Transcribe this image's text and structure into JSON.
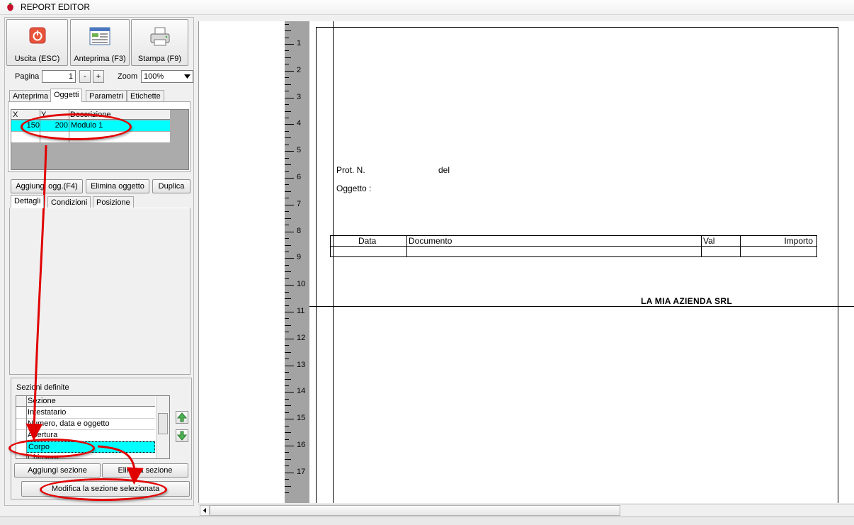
{
  "window": {
    "title": "REPORT EDITOR"
  },
  "toolbar": {
    "exit_label": "Uscita (ESC)",
    "preview_label": "Anteprima (F3)",
    "print_label": "Stampa (F9)",
    "page_label": "Pagina",
    "page_value": "1",
    "minus_label": "-",
    "plus_label": "+",
    "zoom_label": "Zoom",
    "zoom_value": "100%"
  },
  "tabs_top": [
    "Anteprima",
    "Oggetti",
    "Parametri",
    "Etichette"
  ],
  "objects_grid": {
    "headers": [
      "X",
      "Y",
      "Descrizione"
    ],
    "rows": [
      {
        "x": "150",
        "y": "200",
        "desc": "Modulo 1"
      }
    ]
  },
  "object_buttons": {
    "add": "Aggiungi ogg.(F4)",
    "delete": "Elimina oggetto",
    "duplicate": "Duplica"
  },
  "tabs_detail": [
    "Dettagli",
    "Condizioni",
    "Posizione"
  ],
  "sections": {
    "title": "Sezioni definite",
    "header": "Sezione",
    "items": [
      "Intestatario",
      "Numero, data e oggetto",
      "Apertura",
      "Corpo",
      "Chiusura"
    ],
    "add_label": "Aggiungi sezione",
    "delete_label": "Elimina sezione",
    "modify_label": "Modifica la sezione selezionata"
  },
  "ruler": {
    "numbers": [
      "1",
      "2",
      "3",
      "4",
      "5",
      "6",
      "7",
      "8",
      "9",
      "10",
      "11",
      "12",
      "13",
      "14",
      "15",
      "16",
      "17"
    ]
  },
  "document": {
    "prot_label": "Prot. N.",
    "del_label": "del",
    "oggetto_label": "Oggetto :",
    "table_headers": [
      "Data",
      "Documento",
      "Val",
      "Importo"
    ],
    "company": "LA MIA AZIENDA SRL"
  },
  "colors": {
    "accent": "#00ffff",
    "annotation": "#e10000",
    "ruler": "#a3a3a3"
  }
}
